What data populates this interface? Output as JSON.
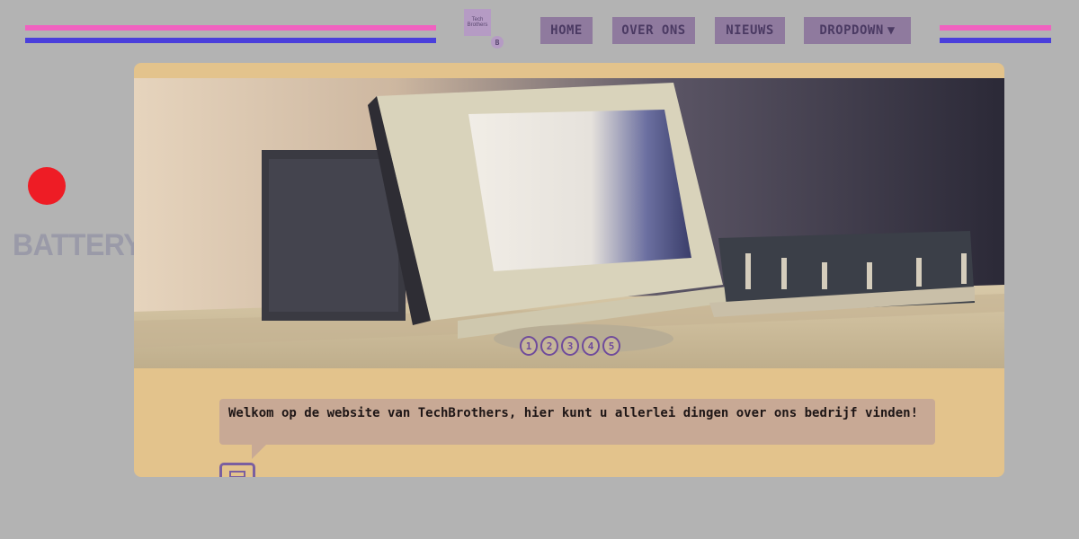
{
  "header": {
    "logo_text": "Tech Brothers",
    "logo_badge": "B",
    "nav": [
      {
        "label": "HOME"
      },
      {
        "label": "OVER ONS"
      },
      {
        "label": "NIEUWS"
      },
      {
        "label": "DROPDOWN",
        "icon": "caret-down-icon"
      }
    ],
    "colors": {
      "stripe_pink": "#f062c0",
      "stripe_blue": "#4a3fdc",
      "nav_bg": "#8f7a9e"
    }
  },
  "sidebar": {
    "battery_label": "BATTERY",
    "battery_status_color": "#ee1c25"
  },
  "carousel": {
    "slides": [
      "1",
      "2",
      "3",
      "4",
      "5"
    ],
    "image": "retro-computer-photo"
  },
  "welcome": {
    "message": "Welkom op de website van TechBrothers, hier kunt u allerlei dingen over ons bedrijf vinden!",
    "icon": "speaker-icon"
  },
  "colors": {
    "page_bg": "#b3b3b3",
    "card_bg": "#e3c38c",
    "bubble_bg": "#c8a995"
  }
}
